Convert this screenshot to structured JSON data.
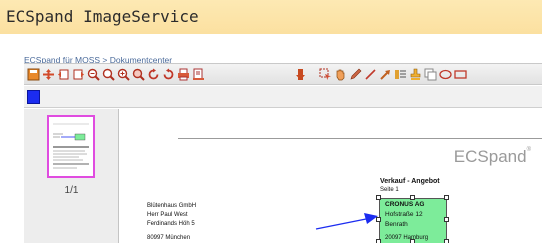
{
  "header": {
    "title": "ECSpand ImageService"
  },
  "breadcrumb": "ECSpand für MOSS > Dokumentcenter",
  "toolbar": {
    "left_icons": [
      "save-icon",
      "move-icon",
      "prev-page-icon",
      "next-page-icon",
      "zoom-out-icon",
      "zoom-fit-icon",
      "zoom-in-icon",
      "zoom-area-icon",
      "rotate-left-icon",
      "rotate-right-icon",
      "print-icon",
      "print-pages-icon"
    ],
    "right_icons": [
      "delete-icon",
      "select-icon",
      "hand-icon",
      "pen-icon",
      "line-icon",
      "arrow-icon",
      "text-icon",
      "stamp-icon",
      "note-icon",
      "ellipse-icon",
      "rectangle-icon"
    ]
  },
  "colorbar": {
    "swatch_color": "#1b2cf0"
  },
  "thumbnails": {
    "page_label": "1/1"
  },
  "document": {
    "brand_name": "ECSpand",
    "brand_mark": "®",
    "heading": "Verkauf - Angebot",
    "page": "Seite 1",
    "recipient": [
      "Blütenhaus GmbH",
      "Herr Paul West",
      "Ferdinands Höh 5"
    ],
    "recipient_city": "80997 München",
    "annotation": {
      "lines": [
        "CRONUS AG",
        "Hofstraße 12",
        "Benrath"
      ],
      "fill": "#7dec9a",
      "arrow_color": "#1b2cf0"
    },
    "sender_city": "20097 Hamburg"
  }
}
